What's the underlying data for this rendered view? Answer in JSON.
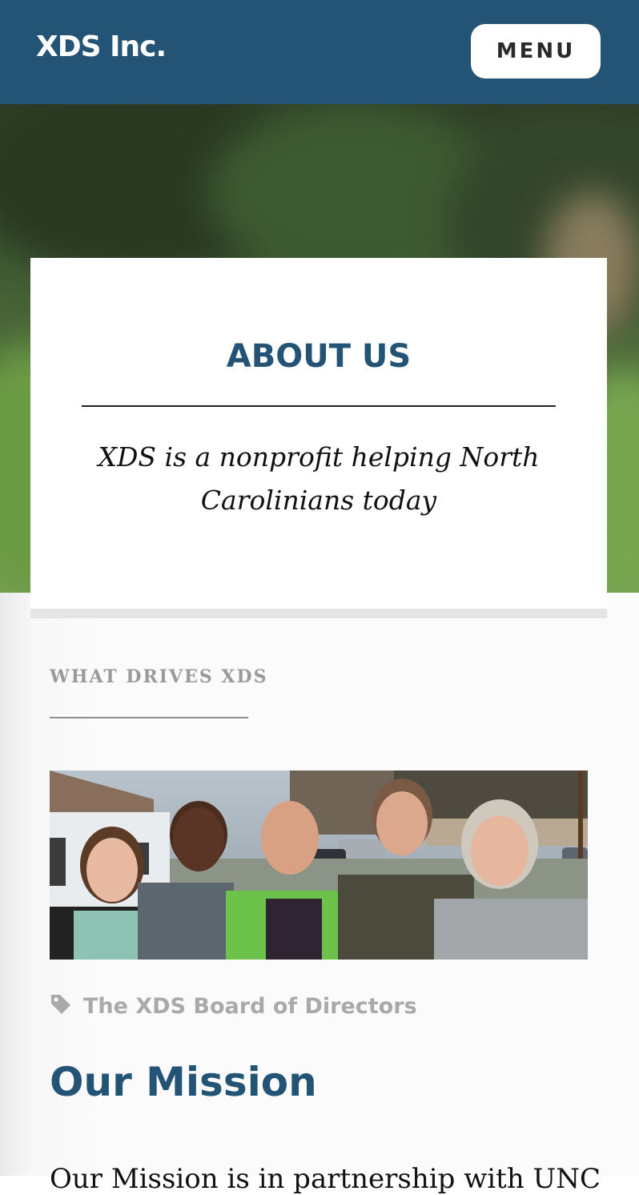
{
  "header": {
    "brand": "XDS Inc.",
    "menu_label": "MENU"
  },
  "hero": {
    "title": "ABOUT US",
    "subtitle": "XDS is a nonprofit helping North Carolinians today"
  },
  "section": {
    "eyebrow": "WHAT DRIVES XDS",
    "photo_caption": "The XDS Board of Directors",
    "mission_title": "Our Mission",
    "mission_text_partial": "Our Mission is in partnership with UNC"
  },
  "colors": {
    "brand_blue": "#235476",
    "muted_gray": "#a9a9a9"
  },
  "icons": {
    "caption_icon": "tag-icon"
  }
}
